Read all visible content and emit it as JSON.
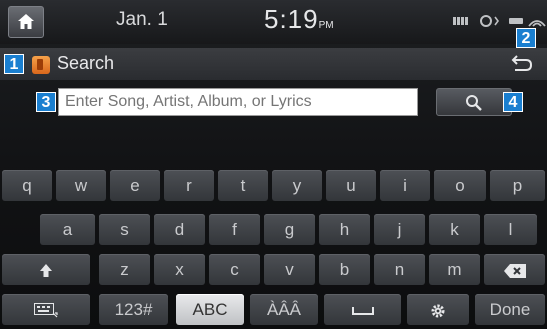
{
  "status": {
    "date": "Jan.  1",
    "time": "5:19",
    "ampm": "PM"
  },
  "titlebar": {
    "title": "Search"
  },
  "search": {
    "placeholder": "Enter Song, Artist, Album, or Lyrics",
    "value": ""
  },
  "badges": [
    "1",
    "2",
    "3",
    "4"
  ],
  "keyboard": {
    "row1": [
      "q",
      "w",
      "e",
      "r",
      "t",
      "y",
      "u",
      "i",
      "o",
      "p"
    ],
    "row2": [
      "a",
      "s",
      "d",
      "f",
      "g",
      "h",
      "j",
      "k",
      "l"
    ],
    "row3": [
      "z",
      "x",
      "c",
      "v",
      "b",
      "n",
      "m"
    ],
    "bottom": {
      "numbers": "123#",
      "abc": "ABC",
      "accents": "ÀÂÂ",
      "done": "Done"
    }
  },
  "icons": [
    "home-icon",
    "signal-icon",
    "back-icon",
    "search-icon",
    "shift-icon",
    "backspace-icon",
    "keyboard-hide-icon",
    "space-icon",
    "settings-icon"
  ]
}
